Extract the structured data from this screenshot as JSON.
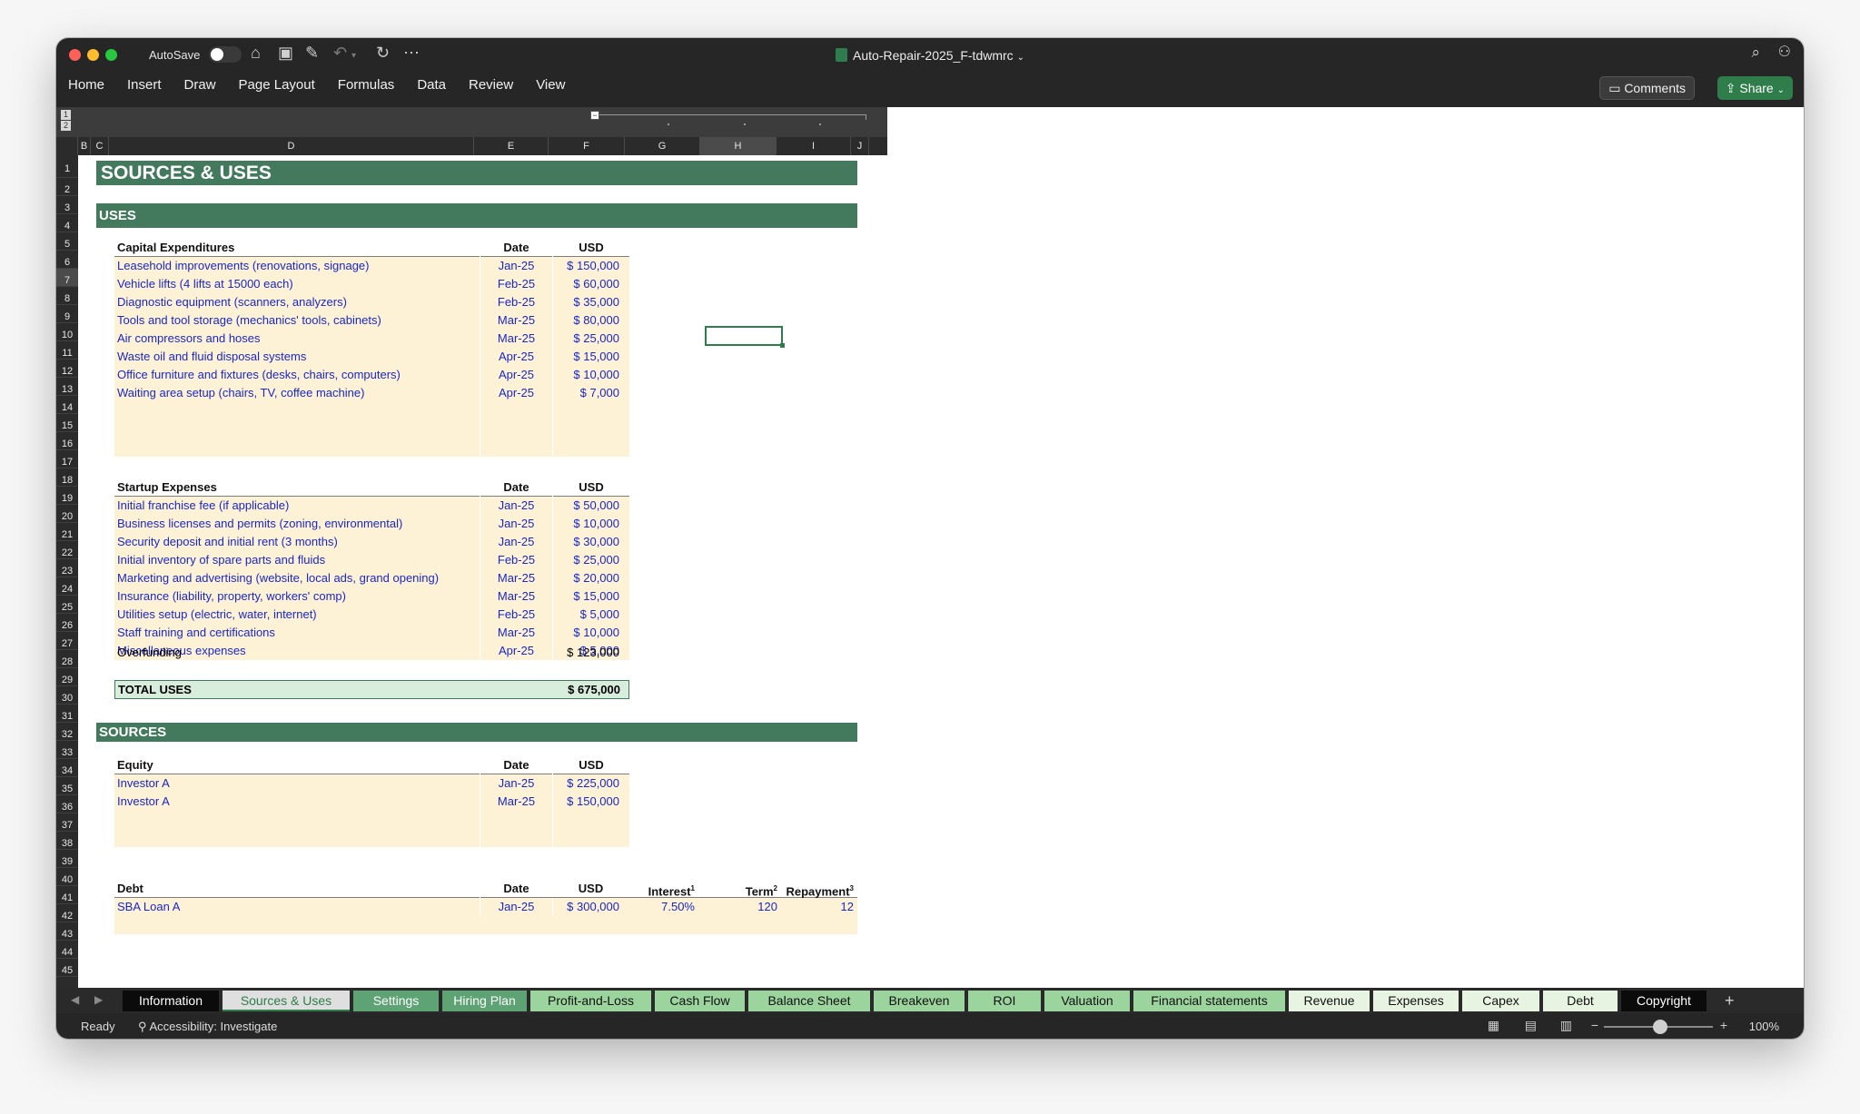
{
  "app": {
    "autosave_label": "AutoSave",
    "doc_title": "Auto-Repair-2025_F-tdwmrc",
    "menu": [
      "Home",
      "Insert",
      "Draw",
      "Page Layout",
      "Formulas",
      "Data",
      "Review",
      "View"
    ],
    "comments_label": "Comments",
    "share_label": "Share"
  },
  "grid": {
    "columns": [
      "B",
      "C",
      "D",
      "E",
      "F",
      "G",
      "H",
      "I",
      "J"
    ],
    "outline_levels": [
      "1",
      "2"
    ],
    "rows": [
      "1",
      "2",
      "3",
      "4",
      "5",
      "6",
      "7",
      "8",
      "9",
      "10",
      "11",
      "12",
      "13",
      "14",
      "15",
      "16",
      "17",
      "18",
      "19",
      "20",
      "21",
      "22",
      "23",
      "24",
      "25",
      "26",
      "27",
      "28",
      "29",
      "30",
      "31",
      "32",
      "33",
      "34",
      "35",
      "36",
      "37",
      "38",
      "39",
      "40",
      "41",
      "42",
      "43",
      "44",
      "45"
    ]
  },
  "sheet": {
    "title": "SOURCES & USES",
    "uses_banner": "USES",
    "sources_banner": "SOURCES",
    "col_date": "Date",
    "col_usd": "USD",
    "capex_header": "Capital Expenditures",
    "capex": [
      {
        "item": "Leasehold improvements (renovations, signage)",
        "date": "Jan-25",
        "usd": "$ 150,000"
      },
      {
        "item": "Vehicle lifts (4 lifts at 15000 each)",
        "date": "Feb-25",
        "usd": "$ 60,000"
      },
      {
        "item": "Diagnostic equipment (scanners, analyzers)",
        "date": "Feb-25",
        "usd": "$ 35,000"
      },
      {
        "item": "Tools and tool storage (mechanics' tools, cabinets)",
        "date": "Mar-25",
        "usd": "$ 80,000"
      },
      {
        "item": "Air compressors and hoses",
        "date": "Mar-25",
        "usd": "$ 25,000"
      },
      {
        "item": "Waste oil and fluid disposal systems",
        "date": "Apr-25",
        "usd": "$ 15,000"
      },
      {
        "item": "Office furniture and fixtures (desks, chairs, computers)",
        "date": "Apr-25",
        "usd": "$ 10,000"
      },
      {
        "item": "Waiting area setup (chairs, TV, coffee machine)",
        "date": "Apr-25",
        "usd": "$ 7,000"
      }
    ],
    "startup_header": "Startup Expenses",
    "startup": [
      {
        "item": "Initial franchise fee (if applicable)",
        "date": "Jan-25",
        "usd": "$ 50,000"
      },
      {
        "item": "Business licenses and permits (zoning, environmental)",
        "date": "Jan-25",
        "usd": "$ 10,000"
      },
      {
        "item": "Security deposit and initial rent (3 months)",
        "date": "Jan-25",
        "usd": "$ 30,000"
      },
      {
        "item": "Initial inventory of spare parts and fluids",
        "date": "Feb-25",
        "usd": "$ 25,000"
      },
      {
        "item": "Marketing and advertising (website, local ads, grand opening)",
        "date": "Mar-25",
        "usd": "$ 20,000"
      },
      {
        "item": "Insurance (liability, property, workers' comp)",
        "date": "Mar-25",
        "usd": "$ 15,000"
      },
      {
        "item": "Utilities setup (electric, water, internet)",
        "date": "Feb-25",
        "usd": "$ 5,000"
      },
      {
        "item": "Staff training and certifications",
        "date": "Mar-25",
        "usd": "$ 10,000"
      },
      {
        "item": "Miscellaneous expenses",
        "date": "Apr-25",
        "usd": "$ 5,000"
      }
    ],
    "overfunding_label": "Overfunding",
    "overfunding_value": "$ 123,000",
    "total_uses_label": "TOTAL USES",
    "total_uses_value": "$ 675,000",
    "equity_header": "Equity",
    "equity": [
      {
        "item": "Investor A",
        "date": "Jan-25",
        "usd": "$ 225,000"
      },
      {
        "item": "Investor A",
        "date": "Mar-25",
        "usd": "$ 150,000"
      }
    ],
    "debt_header": "Debt",
    "debt_interest": "Interest",
    "debt_interest_note": "1",
    "debt_term": "Term",
    "debt_term_note": "2",
    "debt_repayment": "Repayment",
    "debt_repayment_note": "3",
    "debt": [
      {
        "item": "SBA Loan A",
        "date": "Jan-25",
        "usd": "$ 300,000",
        "interest": "7.50%",
        "term": "120",
        "repayment": "12"
      }
    ]
  },
  "tabs": [
    "Information",
    "Sources & Uses",
    "Settings",
    "Hiring Plan",
    "Profit-and-Loss",
    "Cash Flow",
    "Balance Sheet",
    "Breakeven",
    "ROI",
    "Valuation",
    "Financial statements",
    "Revenue",
    "Expenses",
    "Capex",
    "Debt",
    "Copyright"
  ],
  "status": {
    "ready": "Ready",
    "accessibility": "Accessibility: Investigate",
    "zoom": "100%"
  }
}
